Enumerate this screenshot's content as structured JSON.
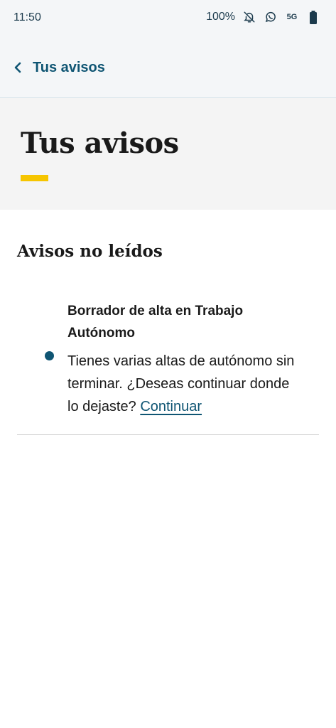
{
  "status_bar": {
    "time": "11:50",
    "battery_percent": "100%",
    "network": "5G",
    "icons": [
      "bell-off-icon",
      "whatsapp-icon",
      "battery-icon"
    ]
  },
  "app_bar": {
    "back_label": "Tus avisos",
    "accent_color": "#0f5573"
  },
  "header": {
    "title": "Tus avisos",
    "accent_bar_color": "#f6c500"
  },
  "unread": {
    "section_title": "Avisos no leídos",
    "items": [
      {
        "title": "Borrador de alta en Trabajo Autónomo",
        "body": "Tienes varias altas de autónomo sin terminar. ¿Deseas continuar donde lo dejaste?",
        "link_label": "Continuar",
        "unread": true
      }
    ]
  }
}
